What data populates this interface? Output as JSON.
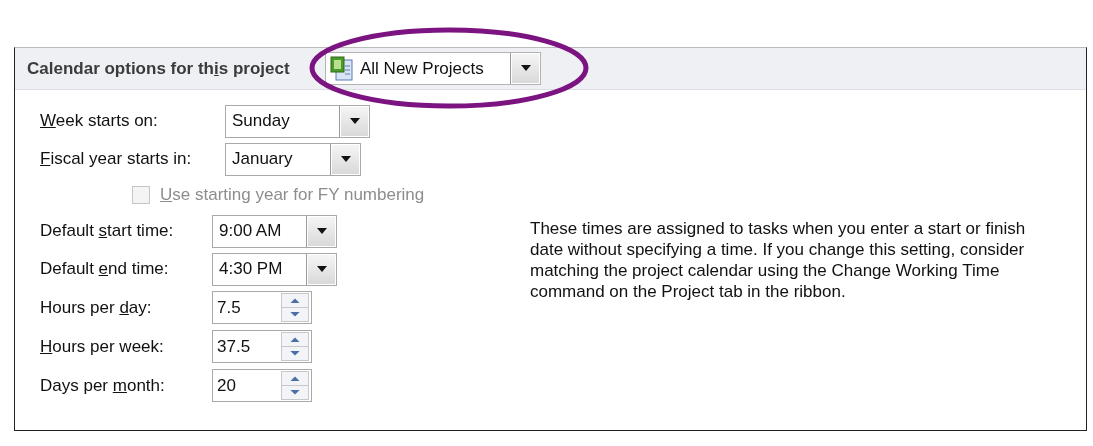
{
  "section": {
    "title": {
      "before": "Calendar options for th",
      "key": "i",
      "after": "s project"
    },
    "scope_dropdown": {
      "value": "All New Projects"
    }
  },
  "fields": [
    {
      "kind": "combo",
      "label": {
        "key": "W",
        "after": "eek starts on:"
      },
      "value": "Sunday"
    },
    {
      "kind": "combo",
      "label": {
        "key": "F",
        "after": "iscal year starts in:"
      },
      "value": "January"
    },
    {
      "kind": "checkbox",
      "label": {
        "key": "U",
        "after": "se starting year for FY numbering"
      },
      "checked": false,
      "disabled": true
    },
    {
      "kind": "combo",
      "label": {
        "before": "Default ",
        "key": "s",
        "after": "tart time:"
      },
      "value": "9:00 AM"
    },
    {
      "kind": "combo",
      "label": {
        "before": "Default ",
        "key": "e",
        "after": "nd time:"
      },
      "value": "4:30 PM"
    },
    {
      "kind": "spin",
      "label": {
        "before": "Hours per ",
        "key": "d",
        "after": "ay:"
      },
      "value": "7.5"
    },
    {
      "kind": "spin",
      "label": {
        "key": "H",
        "after": "ours per week:"
      },
      "value": "37.5"
    },
    {
      "kind": "spin",
      "label": {
        "before": "Days per ",
        "key": "m",
        "after": "onth:"
      },
      "value": "20"
    }
  ],
  "description": "These times are assigned to tasks when you enter a start or finish date without specifying a time. If you change this setting, consider matching the project calendar using the Change Working Time command on the Project tab in the ribbon."
}
